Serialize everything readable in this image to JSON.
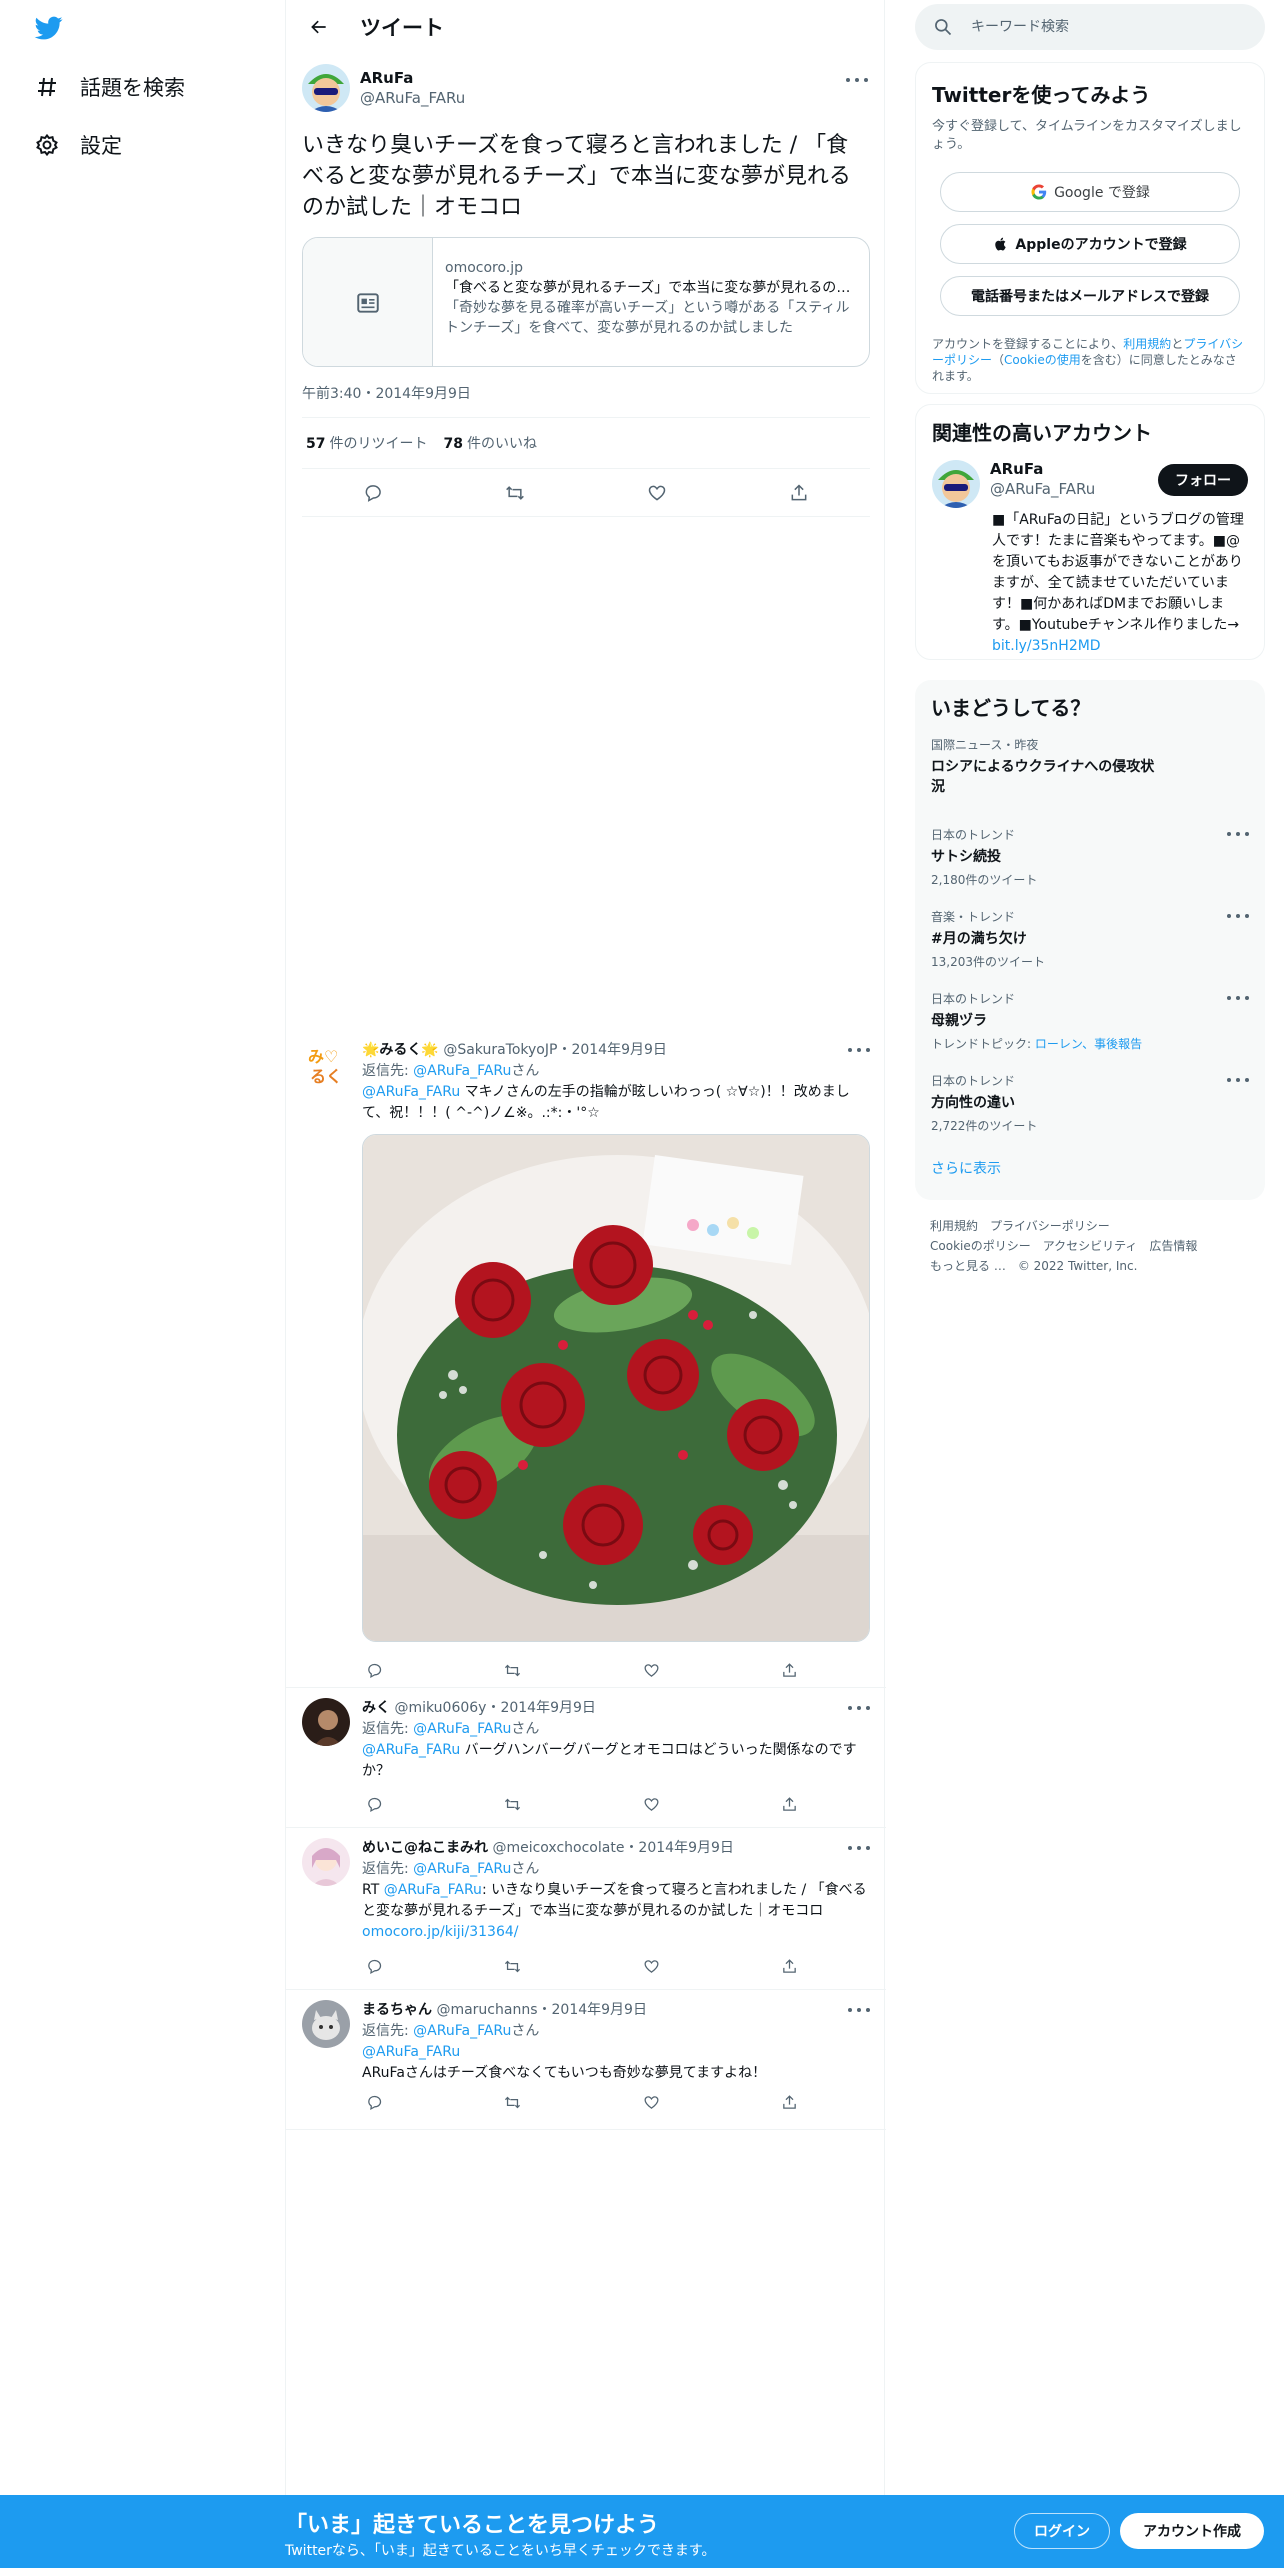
{
  "nav": {
    "explore_label": "話題を検索",
    "settings_label": "設定"
  },
  "header": {
    "title": "ツイート"
  },
  "main_tweet": {
    "name": "ARuFa",
    "handle": "@ARuFa_FARu",
    "text": "いきなり臭いチーズを食って寝ろと言われました / 「食べると変な夢が見れるチーズ」で本当に変な夢が見れるのか試した｜オモコロ",
    "card": {
      "domain": "omocoro.jp",
      "title": "「食べると変な夢が見れるチーズ」で本当に変な夢が見れるのか試した｜オモコロ",
      "description": "「奇妙な夢を見る確率が高いチーズ」という噂がある「スティルトンチーズ」を食べて、変な夢が見れるのか試しました"
    },
    "time": "午前3:40・2014年9月9日",
    "retweets": "57",
    "retweets_label": "件のリツイート",
    "likes": "78",
    "likes_label": "件のいいね"
  },
  "replies": [
    {
      "name": "🌟みるく🌟",
      "handle": "@SakuraTokyoJP",
      "date": "・2014年9月9日",
      "reply_prefix": "返信先: ",
      "reply_to": "@ARuFa_FARu",
      "reply_suffix": "さん",
      "mention": "@ARuFa_FARu",
      "text": " マキノさんの左手の指輪が眩しいわっっ( ☆∀☆)！！改めまして、祝！！！( ^-^)ノ∠※。.:*:・'°☆"
    },
    {
      "name": "みく",
      "handle": "@miku0606y",
      "date": "・2014年9月9日",
      "reply_prefix": "返信先: ",
      "reply_to": "@ARuFa_FARu",
      "reply_suffix": "さん",
      "mention": "@ARuFa_FARu",
      "text": " バーグハンバーグバーグとオモコロはどういった関係なのですか？"
    },
    {
      "name": "めいこ@ねこまみれ",
      "handle": "@meicoxchocolate",
      "date": "・2014年9月9日",
      "rt_prefix": "RT ",
      "mention": "@ARuFa_FARu",
      "text": ": いきなり臭いチーズを食って寝ろと言われました / 「食べると変な夢が見れるチーズ」で本当に変な夢が見れるのか試した｜オモコロ ",
      "link": "omocoro.jp/kiji/31364/"
    },
    {
      "name": "まるちゃん",
      "handle": "@maruchanns",
      "date": "・2014年9月9日",
      "reply_prefix": "返信先: ",
      "reply_to": "@ARuFa_FARu",
      "reply_suffix": "さん",
      "mention": "@ARuFa_FARu",
      "text": "ARuFaさんはチーズ食べなくてもいつも奇妙な夢見てますよね！"
    }
  ],
  "search": {
    "placeholder": "キーワード検索"
  },
  "signup_panel": {
    "title": "Twitterを使ってみよう",
    "subtitle": "今すぐ登録して、タイムラインをカスタマイズしましょう。",
    "google": "Google で登録",
    "apple": "Appleのアカウントで登録",
    "phone": "電話番号またはメールアドレスで登録",
    "terms_a": "アカウントを登録することにより、",
    "terms_link1": "利用規約",
    "terms_b": "と",
    "terms_link2": "プライバシーポリシー",
    "terms_c": "（",
    "terms_link3": "Cookieの使用",
    "terms_d": "を含む）に同意したとみなされます。"
  },
  "related": {
    "title": "関連性の高いアカウント",
    "name": "ARuFa",
    "handle": "@ARuFa_FARu",
    "follow": "フォロー",
    "bio": "■「ARuFaの日記」というブログの管理人です！たまに音楽もやってます。■@を頂いてもお返事ができないことがありますが、全て読ませていただいています！■何かあればDMまでお願いします。■Youtubeチャンネル作りました→ ",
    "bio_link": "bit.ly/35nH2MD"
  },
  "trends": {
    "title": "いまどうしてる？",
    "items": [
      {
        "meta": "国際ニュース・昨夜",
        "topic": "ロシアによるウクライナへの侵攻状況",
        "count": ""
      },
      {
        "meta": "日本のトレンド",
        "topic": "サトシ続投",
        "count": "2,180件のツイート"
      },
      {
        "meta": "音楽・トレンド",
        "topic": "#月の満ち欠け",
        "count": "13,203件のツイート"
      },
      {
        "meta": "日本のトレンド",
        "topic": "母親ヅラ",
        "count": "トレンドトピック: ",
        "count_link": "ローレン、事後報告"
      },
      {
        "meta": "日本のトレンド",
        "topic": "方向性の違い",
        "count": "2,722件のツイート"
      }
    ],
    "more": "さらに表示"
  },
  "footer": {
    "l1": "利用規約",
    "l2": "プライバシーポリシー",
    "l3": "Cookieのポリシー",
    "l4": "アクセシビリティ",
    "l5": "広告情報",
    "l6": "もっと見る …",
    "copy": "© 2022 Twitter, Inc."
  },
  "bottom_bar": {
    "headline": "「いま」起きていることを見つけよう",
    "sub": "Twitterなら、「いま」起きていることをいち早くチェックできます。",
    "login": "ログイン",
    "signup": "アカウント作成"
  },
  "colors": {
    "accent": "#1d9bf0",
    "text": "#0f1419",
    "muted": "#536471"
  }
}
